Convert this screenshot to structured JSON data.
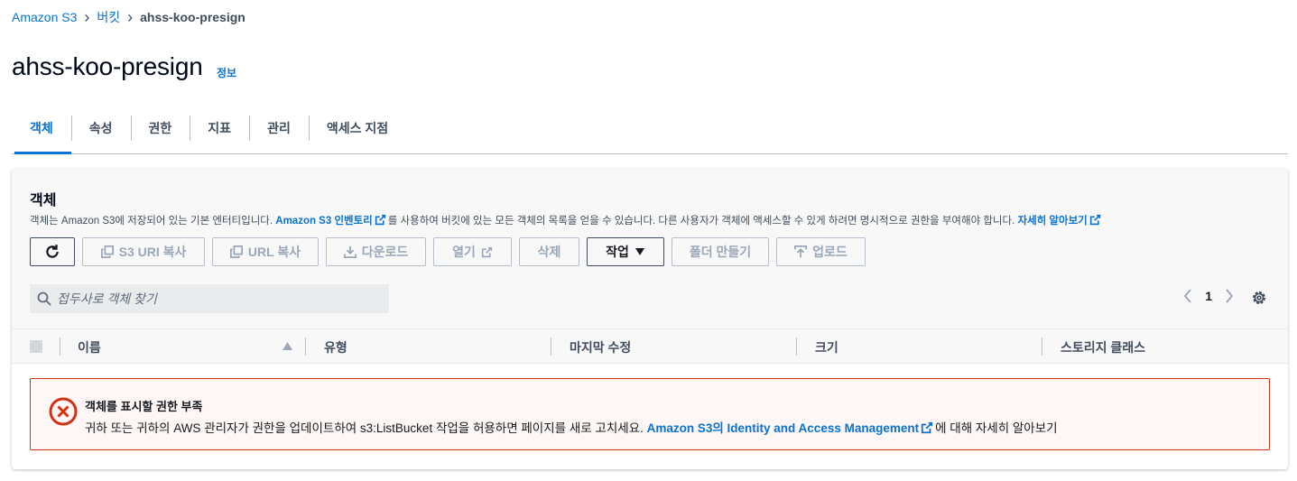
{
  "breadcrumb": {
    "root": "Amazon S3",
    "buckets": "버킷",
    "current": "ahss-koo-presign"
  },
  "header": {
    "title": "ahss-koo-presign",
    "info": "정보"
  },
  "tabs": [
    {
      "label": "객체",
      "active": true
    },
    {
      "label": "속성"
    },
    {
      "label": "권한"
    },
    {
      "label": "지표"
    },
    {
      "label": "관리"
    },
    {
      "label": "액세스 지점"
    }
  ],
  "objects": {
    "title": "객체",
    "desc_part1": "객체는 Amazon S3에 저장되어 있는 기본 엔터티입니다.",
    "desc_link1": "Amazon S3 인벤토리",
    "desc_part2": "를 사용하여 버킷에 있는 모든 객체의 목록을 얻을 수 있습니다. 다른 사용자가 객체에 액세스할 수 있게 하려면 명시적으로 권한을 부여해야 합니다.",
    "desc_link2": "자세히 알아보기",
    "toolbar": {
      "copy_s3_uri": "S3 URI 복사",
      "copy_url": "URL 복사",
      "download": "다운로드",
      "open": "열기",
      "delete": "삭제",
      "actions": "작업",
      "create_folder": "폴더 만들기",
      "upload": "업로드"
    },
    "search_placeholder": "접두사로 객체 찾기",
    "page": "1",
    "columns": {
      "name": "이름",
      "type": "유형",
      "modified": "마지막 수정",
      "size": "크기",
      "storage_class": "스토리지 클래스"
    },
    "alert": {
      "title": "객체를 표시할 권한 부족",
      "body": "귀하 또는 귀하의 AWS 관리자가 권한을 업데이트하여 s3:ListBucket 작업을 허용하면 페이지를 새로 고치세요.",
      "link": "Amazon S3의 Identity and Access Management",
      "tail": "에 대해 자세히 알아보기"
    }
  },
  "colors": {
    "link": "#0972d3",
    "error": "#d13212",
    "disabled": "#9ba7b6"
  }
}
